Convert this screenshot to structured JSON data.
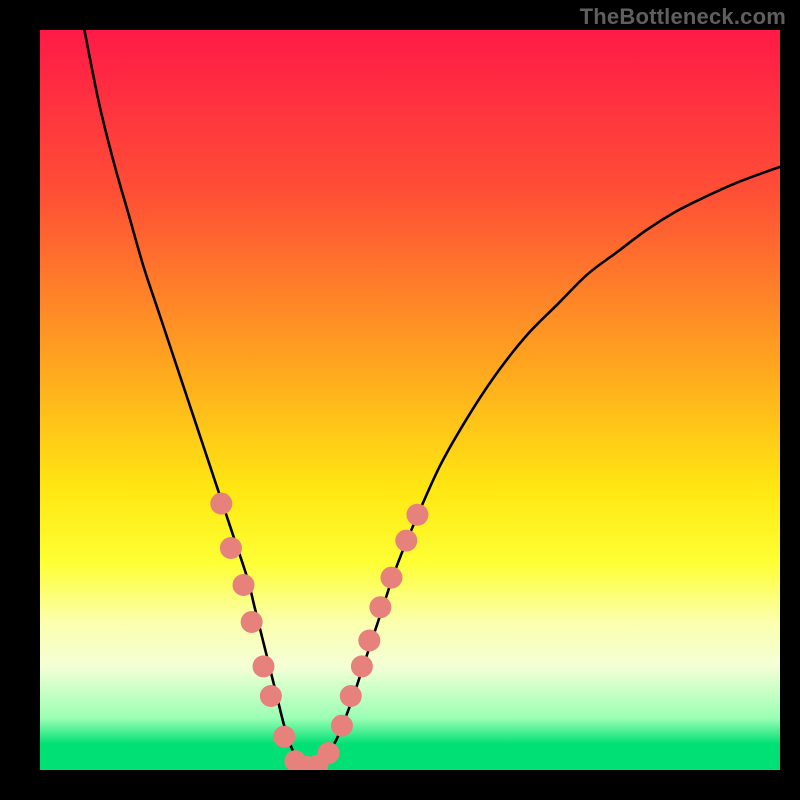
{
  "watermark": "TheBottleneck.com",
  "chart_data": {
    "type": "line",
    "title": "",
    "xlabel": "",
    "ylabel": "",
    "xlim": [
      0,
      100
    ],
    "ylim": [
      0,
      100
    ],
    "grid": false,
    "background_gradient_stops": [
      {
        "offset": 0.0,
        "color": "#ff1a47"
      },
      {
        "offset": 0.22,
        "color": "#ff4f36"
      },
      {
        "offset": 0.45,
        "color": "#ffa41f"
      },
      {
        "offset": 0.62,
        "color": "#ffe712"
      },
      {
        "offset": 0.72,
        "color": "#feff34"
      },
      {
        "offset": 0.8,
        "color": "#fbffad"
      },
      {
        "offset": 0.86,
        "color": "#f4ffd6"
      },
      {
        "offset": 0.93,
        "color": "#9affb3"
      },
      {
        "offset": 0.965,
        "color": "#00e074"
      },
      {
        "offset": 1.0,
        "color": "#00e074"
      }
    ],
    "series": [
      {
        "name": "bottleneck-curve",
        "x": [
          6,
          8,
          10,
          12,
          14,
          16,
          18,
          20,
          22,
          24,
          26,
          28,
          29,
          30,
          31,
          32,
          33,
          34,
          35,
          36,
          37,
          38,
          40,
          42,
          44,
          46,
          48,
          50,
          54,
          58,
          62,
          66,
          70,
          74,
          78,
          82,
          86,
          90,
          94,
          98,
          100
        ],
        "y": [
          100,
          90,
          82,
          75,
          68,
          62,
          56,
          50,
          44,
          38,
          32,
          26,
          22,
          18,
          14,
          10,
          6,
          3,
          1,
          0.4,
          0.4,
          1,
          4,
          9,
          15,
          21,
          27,
          32,
          41,
          48,
          54,
          59,
          63,
          67,
          70,
          73,
          75.5,
          77.5,
          79.3,
          80.8,
          81.5
        ]
      }
    ],
    "markers": {
      "name": "highlight-dots",
      "color": "#e7817b",
      "radius": 11,
      "points": [
        {
          "x": 24.5,
          "y": 36
        },
        {
          "x": 25.8,
          "y": 30
        },
        {
          "x": 27.5,
          "y": 25
        },
        {
          "x": 28.6,
          "y": 20
        },
        {
          "x": 30.2,
          "y": 14
        },
        {
          "x": 31.2,
          "y": 10
        },
        {
          "x": 33.0,
          "y": 4.5
        },
        {
          "x": 34.5,
          "y": 1.2
        },
        {
          "x": 36.0,
          "y": 0.4
        },
        {
          "x": 37.5,
          "y": 0.6
        },
        {
          "x": 39.0,
          "y": 2.3
        },
        {
          "x": 40.8,
          "y": 6
        },
        {
          "x": 42.0,
          "y": 10
        },
        {
          "x": 43.5,
          "y": 14
        },
        {
          "x": 44.5,
          "y": 17.5
        },
        {
          "x": 46.0,
          "y": 22
        },
        {
          "x": 47.5,
          "y": 26
        },
        {
          "x": 49.5,
          "y": 31
        },
        {
          "x": 51.0,
          "y": 34.5
        }
      ]
    }
  }
}
